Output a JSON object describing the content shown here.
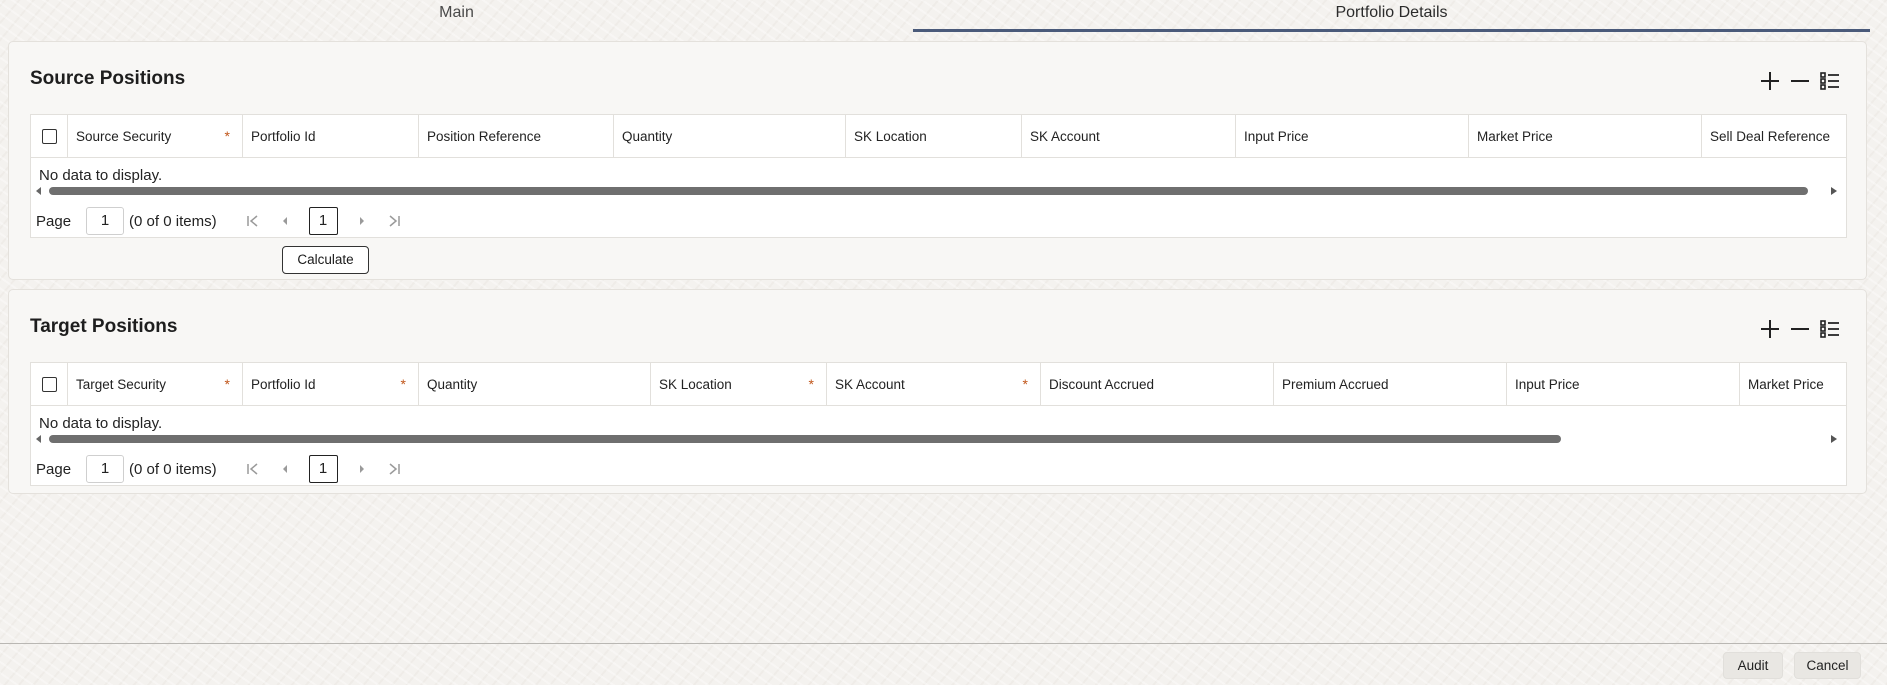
{
  "tabs": [
    {
      "label": "Main"
    },
    {
      "label": "Portfolio Details"
    }
  ],
  "source": {
    "title": "Source Positions",
    "columns": [
      {
        "label": "Source Security",
        "required": "*"
      },
      {
        "label": "Portfolio Id",
        "required": ""
      },
      {
        "label": "Position Reference",
        "required": ""
      },
      {
        "label": "Quantity",
        "required": ""
      },
      {
        "label": "SK Location",
        "required": ""
      },
      {
        "label": "SK Account",
        "required": ""
      },
      {
        "label": "Input Price",
        "required": ""
      },
      {
        "label": "Market Price",
        "required": ""
      },
      {
        "label": "Sell Deal Reference",
        "required": ""
      }
    ],
    "empty_text": "No data to display.",
    "pager": {
      "label": "Page",
      "page_value": "1",
      "info": "(0 of 0 items)",
      "current": "1"
    },
    "calculate_label": "Calculate"
  },
  "target": {
    "title": "Target Positions",
    "columns": [
      {
        "label": "Target Security",
        "required": "*"
      },
      {
        "label": "Portfolio Id",
        "required": "*"
      },
      {
        "label": "Quantity",
        "required": ""
      },
      {
        "label": "SK Location",
        "required": "*"
      },
      {
        "label": "SK Account",
        "required": "*"
      },
      {
        "label": "Discount Accrued",
        "required": ""
      },
      {
        "label": "Premium Accrued",
        "required": ""
      },
      {
        "label": "Input Price",
        "required": ""
      },
      {
        "label": "Market Price",
        "required": ""
      }
    ],
    "empty_text": "No data to display.",
    "pager": {
      "label": "Page",
      "page_value": "1",
      "info": "(0 of 0 items)",
      "current": "1"
    }
  },
  "footer": {
    "audit_label": "Audit",
    "cancel_label": "Cancel"
  },
  "icons": {
    "add": "plus-icon",
    "remove": "minus-icon",
    "single_record_view": "list-view-icon"
  },
  "colors": {
    "required": "#c0561a",
    "tab_underline": "#4a5a7a"
  }
}
